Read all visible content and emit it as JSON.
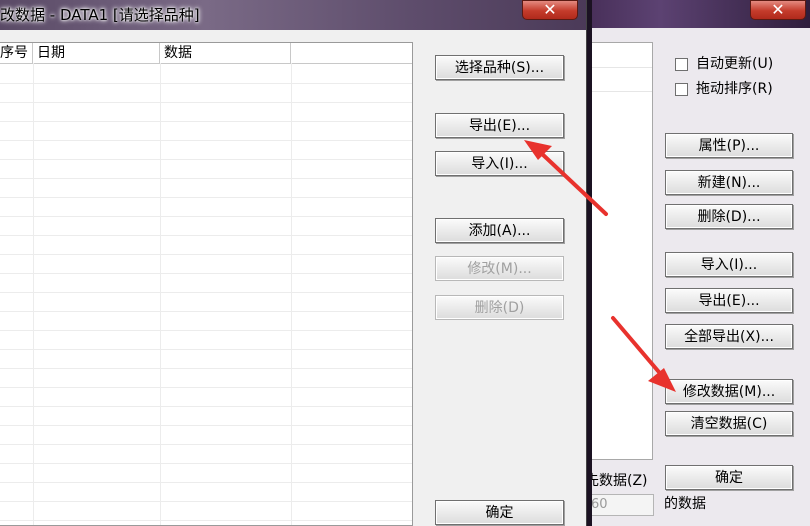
{
  "front_dialog": {
    "title": "改数据 - DATA1 [请选择品种]",
    "close_glyph": "✕",
    "columns": [
      "序号",
      "日期",
      "数据"
    ],
    "buttons": {
      "select_variety": "选择品种(S)...",
      "export": "导出(E)...",
      "import": "导入(I)...",
      "add": "添加(A)...",
      "modify": "修改(M)...",
      "delete": "删除(D)",
      "ok": "确定"
    }
  },
  "back_dialog": {
    "close_glyph": "✕",
    "checkboxes": {
      "auto_update": "自动更新(U)",
      "drag_sort": "拖动排序(R)"
    },
    "buttons": {
      "properties": "属性(P)...",
      "new": "新建(N)...",
      "delete": "删除(D)...",
      "import": "导入(I)...",
      "export": "导出(E)...",
      "export_all": "全部导出(X)...",
      "modify_data": "修改数据(M)...",
      "clear_data": "清空数据(C)",
      "ok": "确定"
    },
    "partial_labels": {
      "select_data": "先数据(Z)",
      "data_suffix": "的数据"
    },
    "partial_input_value": "60"
  },
  "colors": {
    "annotation_arrow": "#e8322d",
    "close_button": "#c43b2b"
  }
}
